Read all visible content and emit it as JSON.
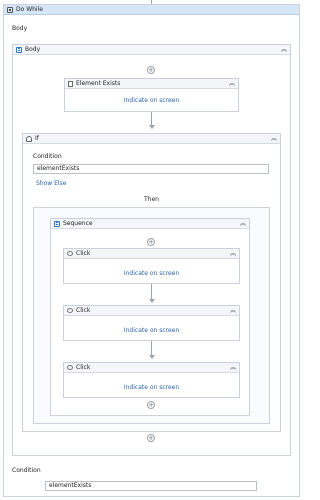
{
  "do_while": {
    "title": "Do While",
    "body_label": "Body"
  },
  "body_sequence": {
    "title": "Body"
  },
  "element_exists": {
    "title": "Element Exists",
    "indicate": "Indicate on screen"
  },
  "if_activity": {
    "title": "If",
    "condition_label": "Condition",
    "condition_value": "elementExists",
    "show_else": "Show Else",
    "then_label": "Then"
  },
  "sequence": {
    "title": "Sequence"
  },
  "clicks": [
    {
      "title": "Click",
      "indicate": "Indicate on screen"
    },
    {
      "title": "Click",
      "indicate": "Indicate on screen"
    },
    {
      "title": "Click",
      "indicate": "Indicate on screen"
    }
  ],
  "footer": {
    "condition_label": "Condition",
    "condition_value": "elementExists"
  },
  "glyphs": {
    "collapse": "︽",
    "plus": "+"
  }
}
